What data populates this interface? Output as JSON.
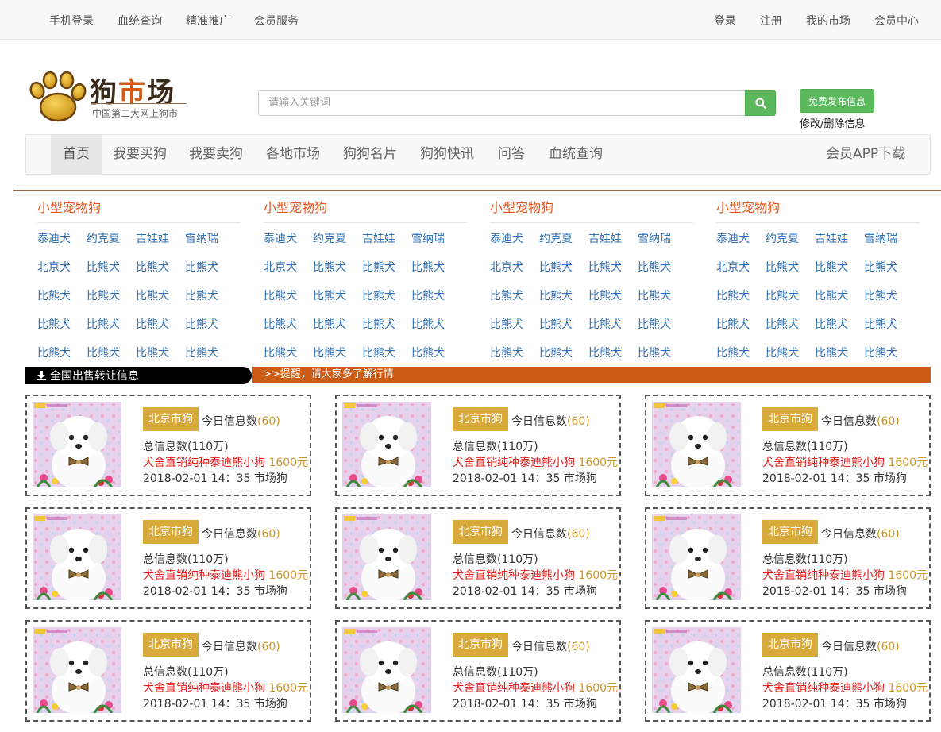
{
  "topbar": {
    "left": [
      "手机登录",
      "血统查询",
      "精准推广",
      "会员服务"
    ],
    "right": [
      "登录",
      "注册",
      "我的市场",
      "会员中心"
    ]
  },
  "logo": {
    "title_part1": "狗",
    "title_part2": "市",
    "title_part3": "场",
    "subtitle": "中国第二大网上狗市"
  },
  "search": {
    "placeholder": "请输入关键词",
    "icon": "search-icon"
  },
  "publish": {
    "button_label": "免费发布信息",
    "edit_link": "修改/删除信息"
  },
  "nav": {
    "items": [
      "首页",
      "我要买狗",
      "我要卖狗",
      "各地市场",
      "狗狗名片",
      "狗狗快讯",
      "问答",
      "血统查询"
    ],
    "active_index": 0,
    "app_download": "会员APP下载"
  },
  "categories": [
    {
      "title": "小型宠物狗",
      "items": [
        "泰迪犬",
        "约克夏",
        "吉娃娃",
        "雪纳瑞",
        "北京犬",
        "比熊犬",
        "比熊犬",
        "比熊犬",
        "比熊犬",
        "比熊犬",
        "比熊犬",
        "比熊犬",
        "比熊犬",
        "比熊犬",
        "比熊犬",
        "比熊犬",
        "比熊犬",
        "比熊犬",
        "比熊犬",
        "比熊犬"
      ]
    },
    {
      "title": "小型宠物狗",
      "items": [
        "泰迪犬",
        "约克夏",
        "吉娃娃",
        "雪纳瑞",
        "北京犬",
        "比熊犬",
        "比熊犬",
        "比熊犬",
        "比熊犬",
        "比熊犬",
        "比熊犬",
        "比熊犬",
        "比熊犬",
        "比熊犬",
        "比熊犬",
        "比熊犬",
        "比熊犬",
        "比熊犬",
        "比熊犬",
        "比熊犬"
      ]
    },
    {
      "title": "小型宠物狗",
      "items": [
        "泰迪犬",
        "约克夏",
        "吉娃娃",
        "雪纳瑞",
        "北京犬",
        "比熊犬",
        "比熊犬",
        "比熊犬",
        "比熊犬",
        "比熊犬",
        "比熊犬",
        "比熊犬",
        "比熊犬",
        "比熊犬",
        "比熊犬",
        "比熊犬",
        "比熊犬",
        "比熊犬",
        "比熊犬",
        "比熊犬"
      ]
    },
    {
      "title": "小型宠物狗",
      "items": [
        "泰迪犬",
        "约克夏",
        "吉娃娃",
        "雪纳瑞",
        "北京犬",
        "比熊犬",
        "比熊犬",
        "比熊犬",
        "比熊犬",
        "比熊犬",
        "比熊犬",
        "比熊犬",
        "比熊犬",
        "比熊犬",
        "比熊犬",
        "比熊犬",
        "比熊犬",
        "比熊犬",
        "比熊犬",
        "比熊犬"
      ]
    }
  ],
  "ribbon": {
    "left_label": "全国出售转让信息",
    "right_label": ">>提醒，请大家多了解行情"
  },
  "listing": {
    "city": "北京市狗",
    "today_label": "今日信息数",
    "today_count": "(60)",
    "total": "总信息数(110万)",
    "title": "犬舍直销纯种泰迪熊小狗",
    "price": "1600元",
    "meta": "2018-02-01 14：35 市场狗"
  },
  "colors": {
    "accent_green": "#5cb85c",
    "category_title": "#e8541e",
    "category_link": "#2f6fb3",
    "ribbon_orange": "#cc5c16",
    "city_badge": "#d8a93b",
    "listing_title": "#e21b1b",
    "price": "#c9972b"
  }
}
